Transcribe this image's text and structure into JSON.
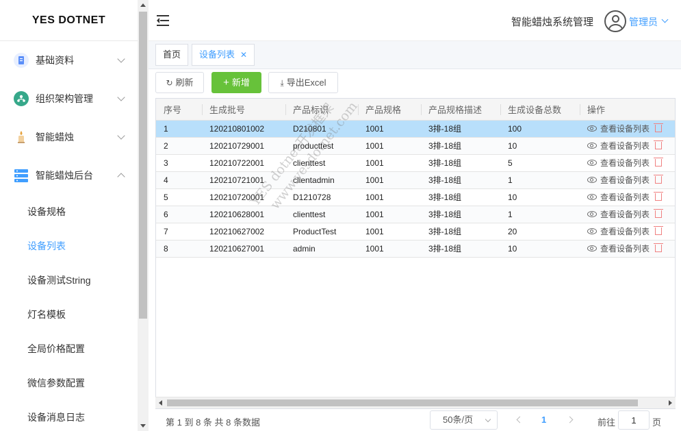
{
  "brand": "YES DOTNET",
  "sidebar": {
    "groups": [
      {
        "label": "基础资料",
        "icon": "document-icon",
        "color": "#5b8ff9"
      },
      {
        "label": "组织架构管理",
        "icon": "org-chart-icon",
        "color": "#36a88a"
      },
      {
        "label": "智能蜡烛",
        "icon": "candle-icon",
        "color": "#d9a066"
      },
      {
        "label": "智能蜡烛后台",
        "icon": "server-icon",
        "color": "#409eff"
      }
    ],
    "sub_items": [
      "设备规格",
      "设备列表",
      "设备测试String",
      "灯名模板",
      "全局价格配置",
      "微信参数配置",
      "设备消息日志"
    ],
    "active_sub": "设备列表"
  },
  "header": {
    "system_title": "智能蜡烛系统管理",
    "user_name": "管理员"
  },
  "tabs": [
    {
      "label": "首页"
    },
    {
      "label": "设备列表",
      "closable": true
    }
  ],
  "toolbar": {
    "refresh": "刷新",
    "add": "新增",
    "export": "导出Excel"
  },
  "table": {
    "columns": [
      "序号",
      "生成批号",
      "产品标识",
      "产品规格",
      "产品规格描述",
      "生成设备总数",
      "操作"
    ],
    "rows": [
      [
        "1",
        "120210801002",
        "D210801",
        "1001",
        "3排-18组",
        "100"
      ],
      [
        "2",
        "120210729001",
        "producttest",
        "1001",
        "3排-18组",
        "10"
      ],
      [
        "3",
        "120210722001",
        "clienttest",
        "1001",
        "3排-18组",
        "5"
      ],
      [
        "4",
        "120210721001",
        "clientadmin",
        "1001",
        "3排-18组",
        "1"
      ],
      [
        "5",
        "120210720001",
        "D1210728",
        "1001",
        "3排-18组",
        "10"
      ],
      [
        "6",
        "120210628001",
        "clienttest",
        "1001",
        "3排-18组",
        "1"
      ],
      [
        "7",
        "120210627002",
        "ProductTest",
        "1001",
        "3排-18组",
        "20"
      ],
      [
        "8",
        "120210627001",
        "admin",
        "1001",
        "3排-18组",
        "10"
      ]
    ],
    "op_label": "查看设备列表",
    "selected_row": 0
  },
  "pager": {
    "info": "第 1 到 8 条 共 8 条数据",
    "page_size": "50条/页",
    "current": "1",
    "goto_label": "前往",
    "goto_value": "1",
    "goto_unit": "页"
  },
  "watermark": {
    "line1": "YES dotnet开发框架",
    "line2": "www.yesdotnet.com"
  }
}
